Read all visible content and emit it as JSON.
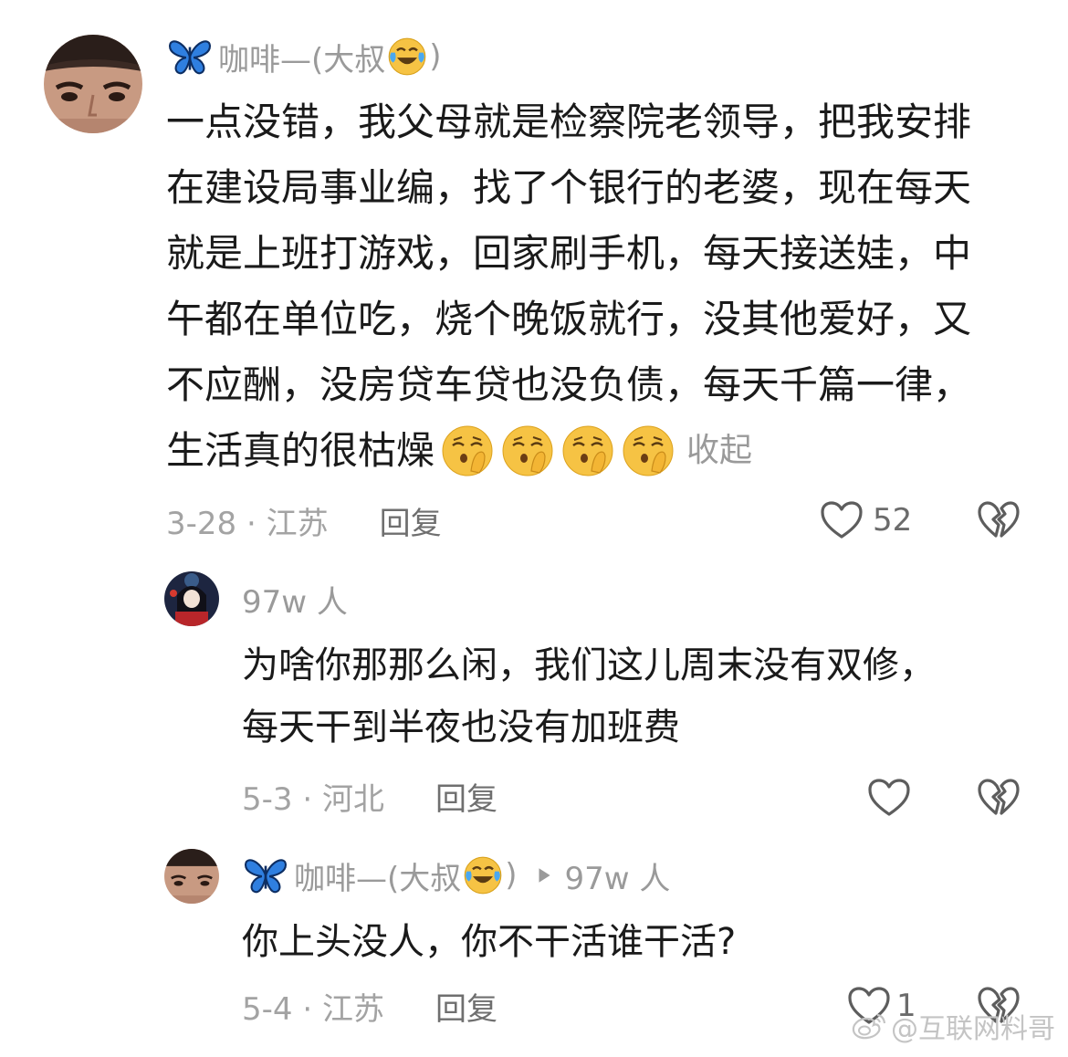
{
  "comments": [
    {
      "author": "咖啡—(大叔",
      "author_suffix": ")",
      "author_emoji": "joy-emoji",
      "text_lines": [
        "一点没错，我父母就是检察院老领导，把我安排",
        "在建设局事业编，找了个银行的老婆，现在每天",
        "就是上班打游戏，回家刷手机，每天接送娃，中",
        "午都在单位吃，烧个晚饭就行，没其他爱好，又",
        "不应酬，没房贷车贷也没负债，每天千篇一律，",
        "生活真的很枯燥"
      ],
      "trailing_emoji": [
        "shushing-emoji",
        "shushing-emoji",
        "shushing-emoji",
        "shushing-emoji"
      ],
      "collapse_label": "收起",
      "date_location": "3-28 · 江苏",
      "reply_label": "回复",
      "like_count": "52"
    },
    {
      "author": "97w 人",
      "text_lines": [
        "为啥你那那么闲，我们这儿周末没有双修，",
        "每天干到半夜也没有加班费"
      ],
      "date_location": "5-3 · 河北",
      "reply_label": "回复",
      "like_count": ""
    },
    {
      "author": "咖啡—(大叔",
      "author_suffix": ")",
      "author_emoji": "joy-emoji",
      "reply_to": "97w 人",
      "text_lines": [
        "你上头没人，你不干活谁干活?"
      ],
      "date_location": "5-4 · 江苏",
      "reply_label": "回复",
      "like_count": "1"
    }
  ],
  "watermark": "@互联网料哥",
  "colors": {
    "text": "#1a1a1a",
    "muted": "#9a9a9a",
    "butterfly": "#2f7fe0",
    "emoji": "#f6c344"
  }
}
